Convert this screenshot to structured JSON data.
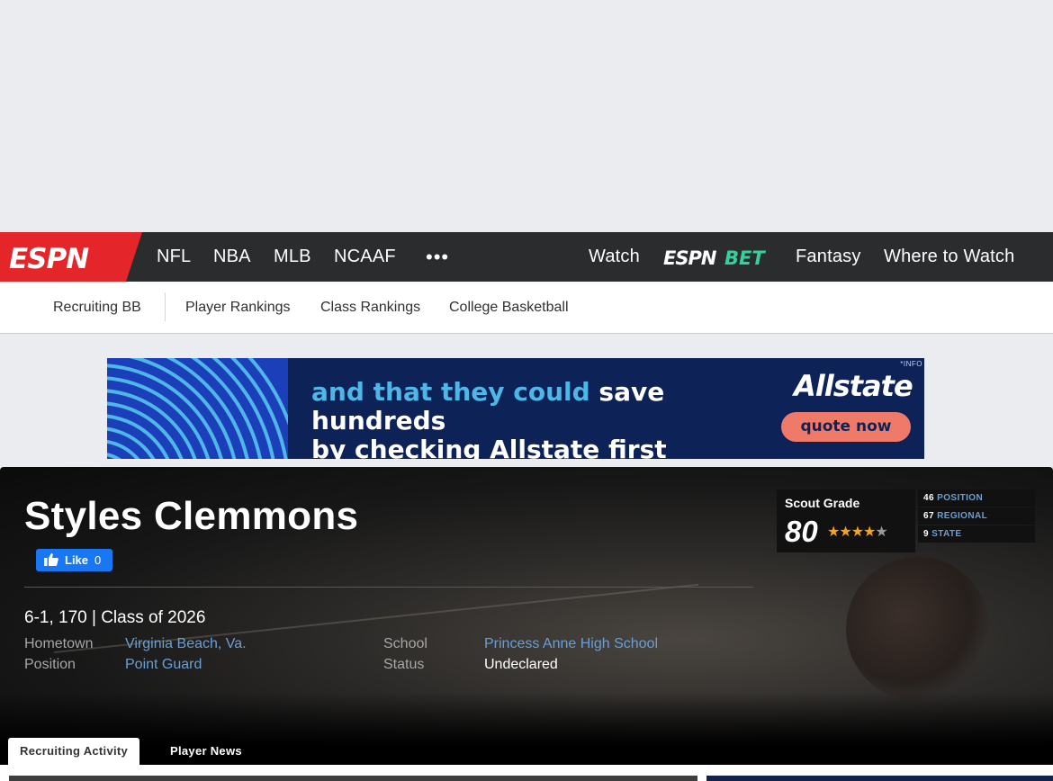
{
  "nav": {
    "logo_text": "ESPN",
    "left_links": [
      "NFL",
      "NBA",
      "MLB",
      "NCAAF"
    ],
    "more": "•••",
    "right_links": {
      "watch": "Watch",
      "bet": "ESPN BET",
      "fantasy": "Fantasy",
      "where": "Where to Watch"
    },
    "brand_red": "#e4262b",
    "bet_green": "#34d19a"
  },
  "subnav": {
    "items": [
      "Recruiting BB",
      "Player Rankings",
      "Class Rankings",
      "College Basketball"
    ]
  },
  "ad": {
    "line1_highlight": "and that they could",
    "line1_rest": " save hundreds",
    "line2": "by checking Allstate first",
    "brand": "Allstate",
    "cta": "quote now",
    "info": "*INFO"
  },
  "player": {
    "name": "Styles Clemmons",
    "like_label": "Like",
    "like_count": "0",
    "bio": "6-1, 170 | Class of 2026",
    "fields": {
      "hometown_label": "Hometown",
      "hometown": "Virginia Beach, Va.",
      "position_label": "Position",
      "position": "Point Guard",
      "school_label": "School",
      "school": "Princess Anne High School",
      "status_label": "Status",
      "status": "Undeclared"
    },
    "scout": {
      "title": "Scout Grade",
      "grade": "80",
      "stars_filled": 4,
      "stars_total": 5
    },
    "ranks": [
      {
        "value": "46",
        "label": "POSITION"
      },
      {
        "value": "67",
        "label": "REGIONAL"
      },
      {
        "value": "9",
        "label": "STATE"
      }
    ]
  },
  "tabs": [
    "Recruiting Activity",
    "Player News"
  ]
}
